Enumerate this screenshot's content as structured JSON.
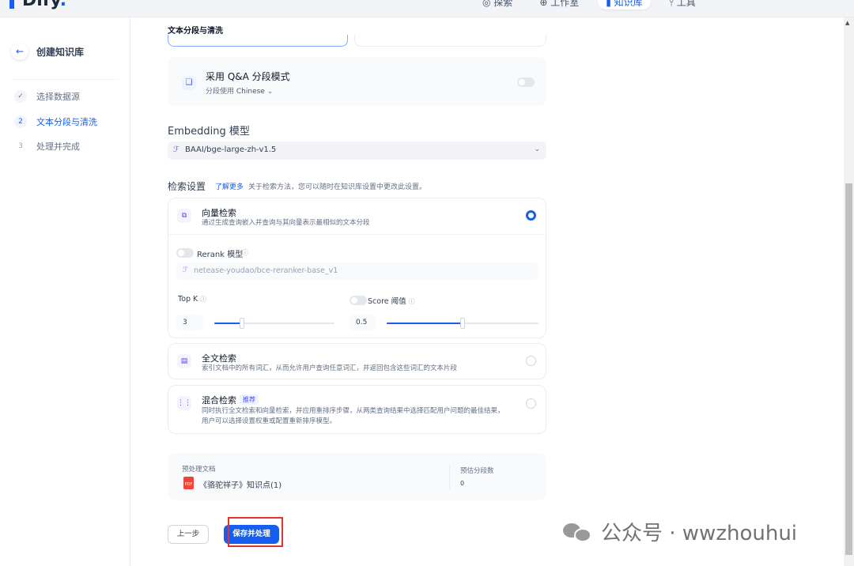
{
  "app": {
    "logo_text": "Dify",
    "nav": [
      {
        "label": "探索",
        "icon": "compass-icon"
      },
      {
        "label": "工作室",
        "icon": "briefcase-icon"
      },
      {
        "label": "知识库",
        "icon": "book-icon"
      },
      {
        "label": "工具",
        "icon": "tool-icon"
      }
    ]
  },
  "sidebar": {
    "title": "创建知识库",
    "steps": [
      {
        "num": "✓",
        "label": "选择数据源",
        "state": "done"
      },
      {
        "num": "2",
        "label": "文本分段与清洗",
        "state": "active"
      },
      {
        "num": "3",
        "label": "处理并完成",
        "state": "pending"
      }
    ]
  },
  "main": {
    "section_title": "文本分段与清洗",
    "qa": {
      "title": "采用 Q&A 分段模式",
      "sub_prefix": "分段使用",
      "language": "Chinese",
      "enabled": false
    },
    "embedding": {
      "label": "Embedding 模型",
      "model": "BAAI/bge-large-zh-v1.5"
    },
    "retrieval": {
      "label": "检索设置",
      "learn_more": "了解更多",
      "desc": "关于检索方法，您可以随时在知识库设置中更改此设置。",
      "vector": {
        "title": "向量检索",
        "desc": "通过生成查询嵌入并查询与其向量表示最相似的文本分段",
        "selected": true,
        "rerank_label": "Rerank 模型",
        "rerank_model": "netease-youdao/bce-reranker-base_v1",
        "topk_label": "Top K",
        "topk_value": "3",
        "score_label": "Score 阈值",
        "score_value": "0.5"
      },
      "fulltext": {
        "title": "全文检索",
        "desc": "索引文档中的所有词汇，从而允许用户查询任意词汇，并返回包含这些词汇的文本片段",
        "selected": false
      },
      "hybrid": {
        "title": "混合检索",
        "badge": "推荐",
        "desc1": "同时执行全文检索和向量检索，并应用重排序步骤，从两类查询结果中选择匹配用户问题的最佳结果，",
        "desc2": "用户可以选择设置权重或配置重新排序模型。",
        "selected": false
      }
    },
    "preview": {
      "doc_label": "预处理文档",
      "file_name": "《骆驼祥子》知识点(1)",
      "est_label": "预估分段数",
      "est_value": "0"
    },
    "buttons": {
      "prev": "上一步",
      "save": "保存并处理"
    }
  },
  "watermark": "公众号 · wwzhouhui",
  "colors": {
    "primary": "#155eef",
    "highlight": "#e5322d"
  }
}
